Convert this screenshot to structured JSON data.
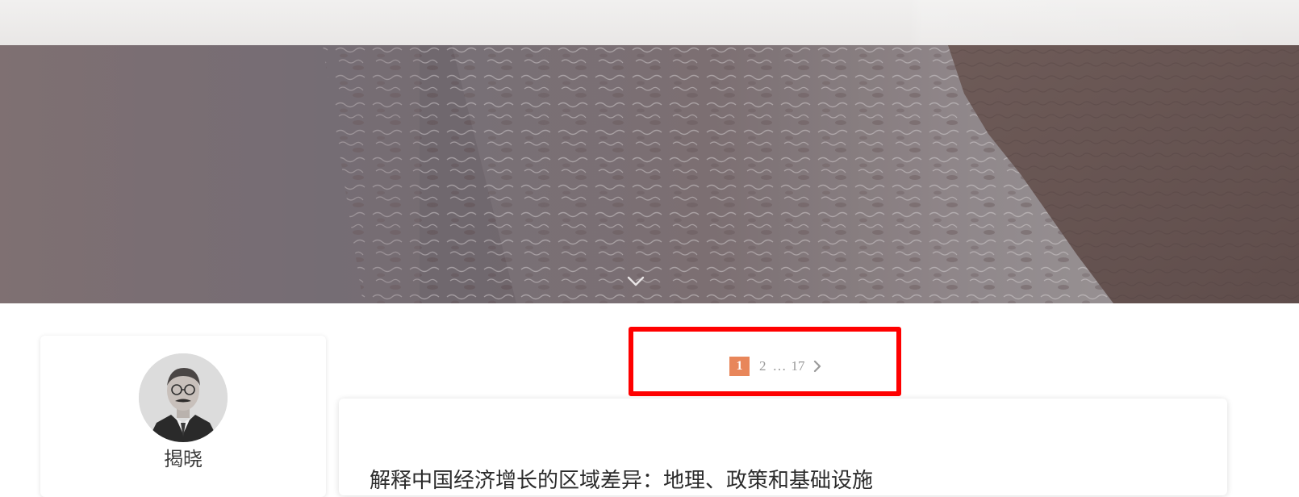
{
  "profile": {
    "name": "揭晓",
    "avatar_icon": "portrait-avatar"
  },
  "pagination": {
    "current": "1",
    "next_page": "2",
    "ellipsis": "…",
    "last_page": "17",
    "next_icon": "chevron-right-icon"
  },
  "post": {
    "title": "解释中国经济增长的区域差异：地理、政策和基础设施"
  },
  "colors": {
    "accent": "#e8865a",
    "highlight": "#ff0000",
    "hero_tint": "#6b6468"
  }
}
